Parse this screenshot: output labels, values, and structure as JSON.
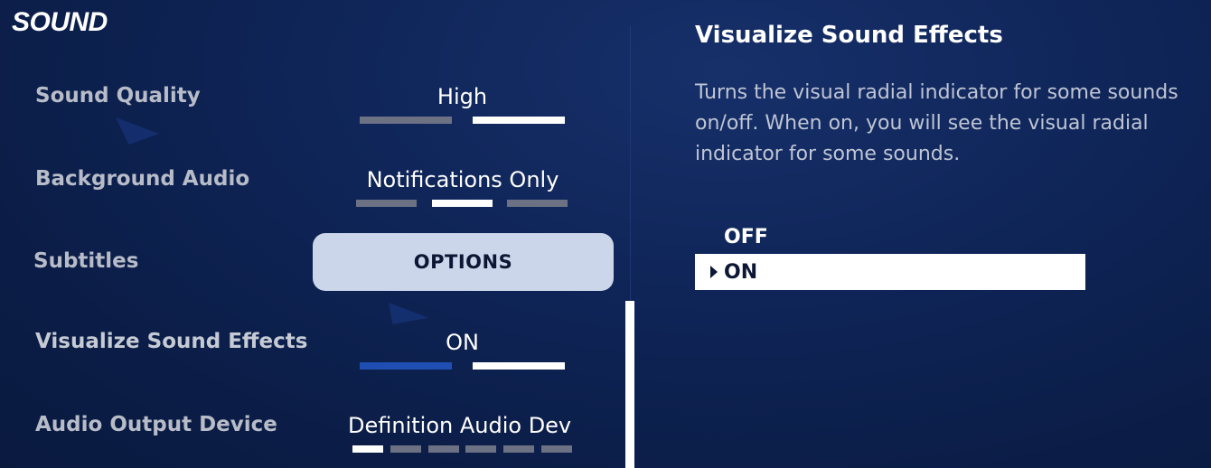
{
  "header": {
    "title": "SOUND"
  },
  "settings": [
    {
      "label": "Sound Quality",
      "value": "High",
      "segments": 2,
      "selected_index": 1
    },
    {
      "label": "Background Audio",
      "value": "Notifications Only",
      "segments": 3,
      "selected_index": 1
    },
    {
      "label": "Subtitles",
      "button_label": "OPTIONS"
    },
    {
      "label": "Visualize Sound Effects",
      "value": "ON",
      "segments": 2,
      "selected_index": 1
    },
    {
      "label": "Audio Output Device",
      "value": "Definition Audio Dev",
      "segments": 6,
      "selected_index": 0
    }
  ],
  "detail": {
    "title": "Visualize Sound Effects",
    "description": "Turns the visual radial indicator for some sounds on/off.  When on, you will see the visual radial indicator for some sounds.",
    "options": [
      "OFF",
      "ON"
    ],
    "selected": "ON"
  },
  "colors": {
    "background": "#0f2558",
    "accent_blue": "#1f4fb3",
    "button_bg": "#ccd6ea",
    "label_gray": "#b7bcc8"
  }
}
